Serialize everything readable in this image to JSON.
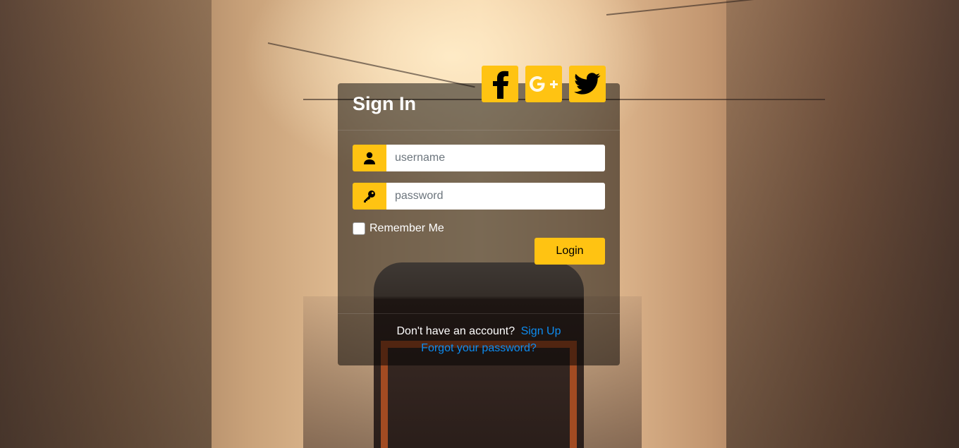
{
  "login": {
    "title": "Sign In",
    "username": {
      "placeholder": "username",
      "icon": "user-icon"
    },
    "password": {
      "placeholder": "password",
      "icon": "key-icon"
    },
    "remember_label": "Remember Me",
    "remember_checked": false,
    "login_label": "Login",
    "no_account_text": "Don't have an account?",
    "signup_link": "Sign Up",
    "forgot_link": "Forgot your password?"
  },
  "social": [
    {
      "name": "facebook",
      "icon": "facebook-icon"
    },
    {
      "name": "google-plus",
      "icon": "google-plus-icon"
    },
    {
      "name": "twitter",
      "icon": "twitter-icon"
    }
  ],
  "colors": {
    "accent": "#ffc312",
    "link": "#0d8cf0",
    "panel_bg": "rgba(0,0,0,0.5)",
    "text": "#ffffff"
  }
}
